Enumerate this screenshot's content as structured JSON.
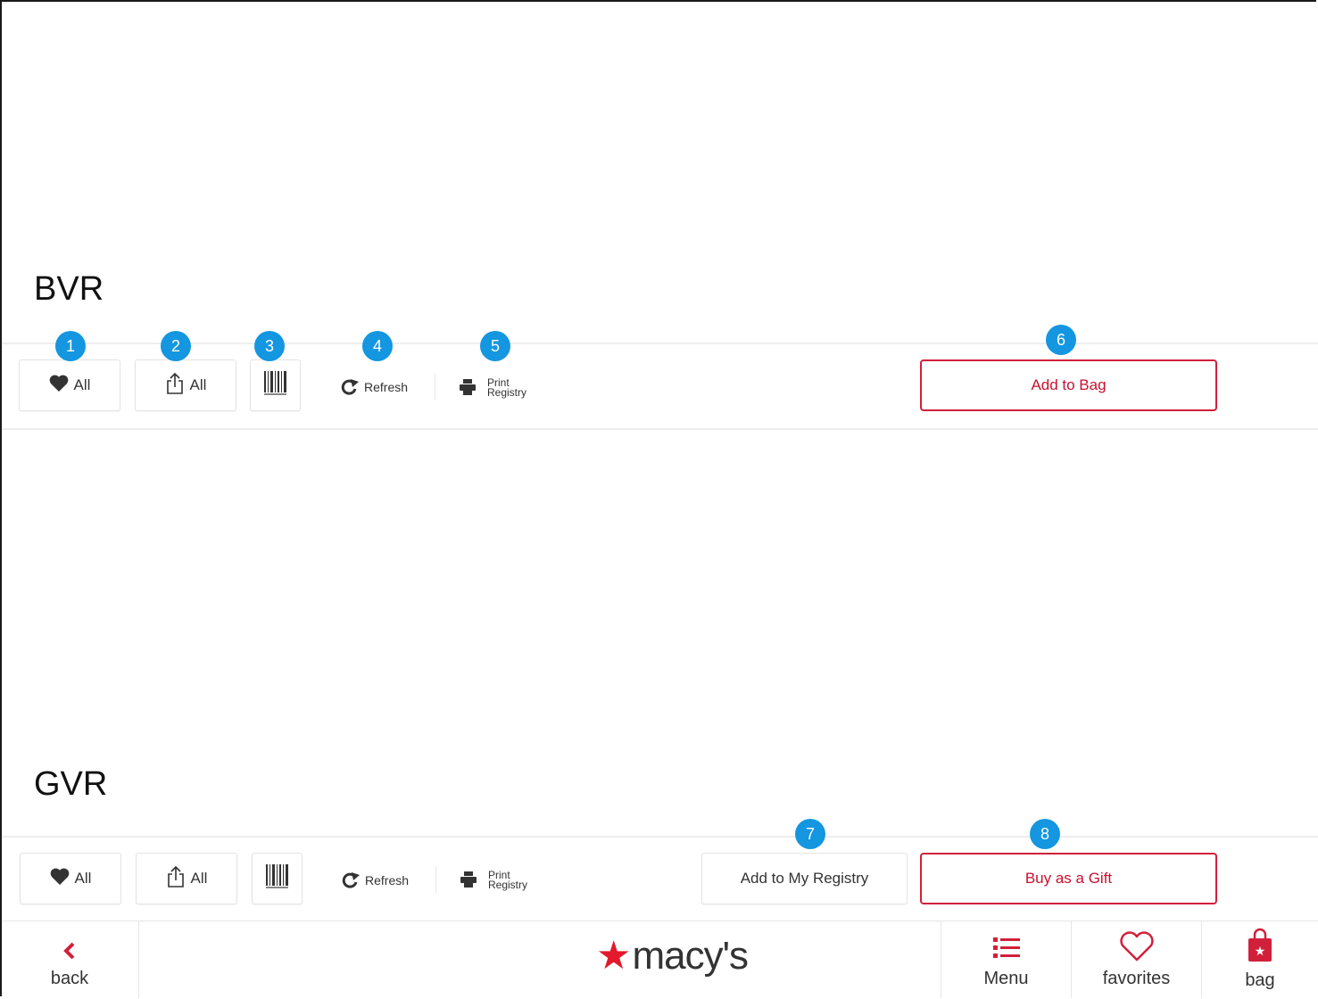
{
  "sections": {
    "bvr_label": "BVR",
    "gvr_label": "GVR"
  },
  "toolbar": {
    "favorite_all_label": "All",
    "share_all_label": "All",
    "refresh_label": "Refresh",
    "print_line1": "Print",
    "print_line2": "Registry"
  },
  "bvr": {
    "add_to_bag_label": "Add to Bag",
    "badges": [
      "1",
      "2",
      "3",
      "4",
      "5",
      "6"
    ]
  },
  "gvr": {
    "add_to_registry_label": "Add to My Registry",
    "buy_as_gift_label": "Buy as a Gift",
    "badges": [
      "7",
      "8"
    ]
  },
  "bottom_nav": {
    "back_label": "back",
    "logo_text": "macy's",
    "menu_label": "Menu",
    "favorites_label": "favorites",
    "bag_label": "bag"
  },
  "colors": {
    "accent_red": "#c8102e",
    "badge_blue": "#1496e0"
  },
  "icons": [
    "heart-icon",
    "share-icon",
    "barcode-icon",
    "refresh-icon",
    "printer-icon",
    "chevron-left-icon",
    "star-icon",
    "menu-icon",
    "heart-outline-icon",
    "shopping-bag-icon"
  ]
}
